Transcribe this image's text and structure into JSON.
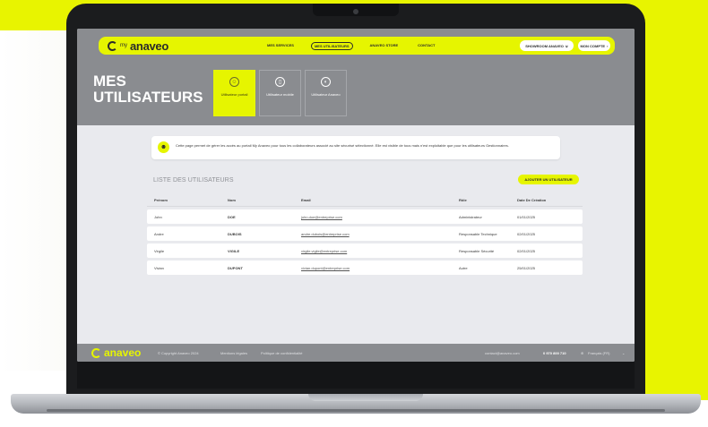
{
  "brand": {
    "logo_prefix": "my",
    "logo_name": "anaveo",
    "accent_color": "#e6f500",
    "hero_color": "#8a8c90"
  },
  "nav": {
    "items": [
      "MES SERVICES",
      "MES UTILISATEURS",
      "ANAVEO STORE",
      "CONTACT"
    ],
    "active": "MES UTILISATEURS",
    "showroom_label": "SHOWROOM ANAVEO",
    "account_label": "MON COMPTE"
  },
  "page": {
    "title": "MES UTILISATEURS"
  },
  "tiles": [
    {
      "label": "Utilisateur portail",
      "icon": "user-icon",
      "active": true
    },
    {
      "label": "Utilisateur mobile",
      "icon": "mobile-icon",
      "active": false
    },
    {
      "label": "Utilisateur Anaveo",
      "icon": "anaveo-icon",
      "active": false
    }
  ],
  "info": {
    "text": "Cette page permet de gérer les accès au portail My Anaveo pour tous les collaborateurs associé au site sécurisé sélectionné. Elle est visible de tous mais n'est exploitable que pour les utilisateurs Gestionnaires."
  },
  "list": {
    "title": "LISTE DES UTILISATEURS",
    "add_button": "AJOUTER UN UTILISATEUR",
    "columns": [
      "Prénom",
      "Nom",
      "Email",
      "Rôle",
      "Date De Création"
    ],
    "rows": [
      [
        "John",
        "DOE",
        "john.doe@entreprise.com",
        "Administrateur",
        "01/01/2025"
      ],
      [
        "Andre",
        "DUBOIS",
        "andre.dubois@entreprise.com",
        "Responsable Technique",
        "02/01/2025"
      ],
      [
        "Virgile",
        "VIGILE",
        "virgile.vigile@entreprise.com",
        "Responsable Sécurité",
        "02/01/2025"
      ],
      [
        "Vivian",
        "DUPONT",
        "vivian.dupont@entreprise.com",
        "Autre",
        "25/01/2025"
      ]
    ]
  },
  "footer": {
    "logo": "anaveo",
    "copyright": "© Copyright Anaveo 2024",
    "legal": "Mentions légales",
    "privacy": "Politique de confidentialité",
    "email": "contact@anaveo.com",
    "phone": "0 970 800 710",
    "language": "Français (FR)"
  }
}
